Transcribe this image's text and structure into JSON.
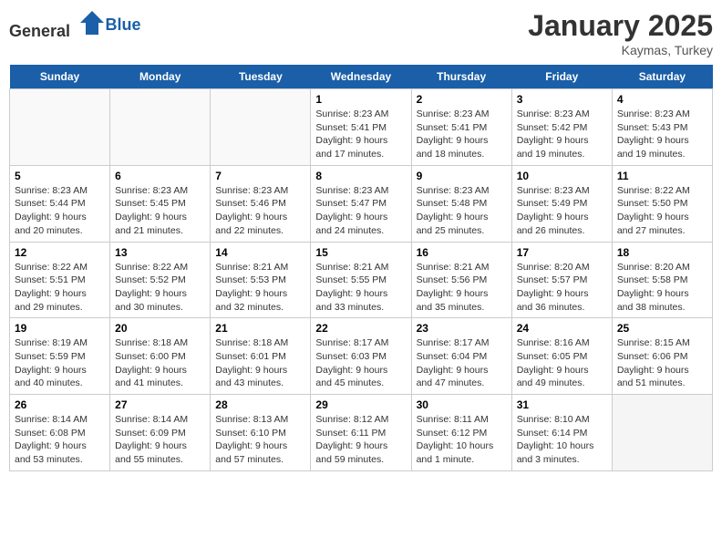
{
  "header": {
    "logo_general": "General",
    "logo_blue": "Blue",
    "title": "January 2025",
    "subtitle": "Kaymas, Turkey"
  },
  "weekdays": [
    "Sunday",
    "Monday",
    "Tuesday",
    "Wednesday",
    "Thursday",
    "Friday",
    "Saturday"
  ],
  "weeks": [
    [
      {
        "day": "",
        "empty": true
      },
      {
        "day": "",
        "empty": true
      },
      {
        "day": "",
        "empty": true
      },
      {
        "day": "1",
        "sunrise": "8:23 AM",
        "sunset": "5:41 PM",
        "daylight": "9 hours and 17 minutes."
      },
      {
        "day": "2",
        "sunrise": "8:23 AM",
        "sunset": "5:41 PM",
        "daylight": "9 hours and 18 minutes."
      },
      {
        "day": "3",
        "sunrise": "8:23 AM",
        "sunset": "5:42 PM",
        "daylight": "9 hours and 19 minutes."
      },
      {
        "day": "4",
        "sunrise": "8:23 AM",
        "sunset": "5:43 PM",
        "daylight": "9 hours and 19 minutes."
      }
    ],
    [
      {
        "day": "5",
        "sunrise": "8:23 AM",
        "sunset": "5:44 PM",
        "daylight": "9 hours and 20 minutes."
      },
      {
        "day": "6",
        "sunrise": "8:23 AM",
        "sunset": "5:45 PM",
        "daylight": "9 hours and 21 minutes."
      },
      {
        "day": "7",
        "sunrise": "8:23 AM",
        "sunset": "5:46 PM",
        "daylight": "9 hours and 22 minutes."
      },
      {
        "day": "8",
        "sunrise": "8:23 AM",
        "sunset": "5:47 PM",
        "daylight": "9 hours and 24 minutes."
      },
      {
        "day": "9",
        "sunrise": "8:23 AM",
        "sunset": "5:48 PM",
        "daylight": "9 hours and 25 minutes."
      },
      {
        "day": "10",
        "sunrise": "8:23 AM",
        "sunset": "5:49 PM",
        "daylight": "9 hours and 26 minutes."
      },
      {
        "day": "11",
        "sunrise": "8:22 AM",
        "sunset": "5:50 PM",
        "daylight": "9 hours and 27 minutes."
      }
    ],
    [
      {
        "day": "12",
        "sunrise": "8:22 AM",
        "sunset": "5:51 PM",
        "daylight": "9 hours and 29 minutes."
      },
      {
        "day": "13",
        "sunrise": "8:22 AM",
        "sunset": "5:52 PM",
        "daylight": "9 hours and 30 minutes."
      },
      {
        "day": "14",
        "sunrise": "8:21 AM",
        "sunset": "5:53 PM",
        "daylight": "9 hours and 32 minutes."
      },
      {
        "day": "15",
        "sunrise": "8:21 AM",
        "sunset": "5:55 PM",
        "daylight": "9 hours and 33 minutes."
      },
      {
        "day": "16",
        "sunrise": "8:21 AM",
        "sunset": "5:56 PM",
        "daylight": "9 hours and 35 minutes."
      },
      {
        "day": "17",
        "sunrise": "8:20 AM",
        "sunset": "5:57 PM",
        "daylight": "9 hours and 36 minutes."
      },
      {
        "day": "18",
        "sunrise": "8:20 AM",
        "sunset": "5:58 PM",
        "daylight": "9 hours and 38 minutes."
      }
    ],
    [
      {
        "day": "19",
        "sunrise": "8:19 AM",
        "sunset": "5:59 PM",
        "daylight": "9 hours and 40 minutes."
      },
      {
        "day": "20",
        "sunrise": "8:18 AM",
        "sunset": "6:00 PM",
        "daylight": "9 hours and 41 minutes."
      },
      {
        "day": "21",
        "sunrise": "8:18 AM",
        "sunset": "6:01 PM",
        "daylight": "9 hours and 43 minutes."
      },
      {
        "day": "22",
        "sunrise": "8:17 AM",
        "sunset": "6:03 PM",
        "daylight": "9 hours and 45 minutes."
      },
      {
        "day": "23",
        "sunrise": "8:17 AM",
        "sunset": "6:04 PM",
        "daylight": "9 hours and 47 minutes."
      },
      {
        "day": "24",
        "sunrise": "8:16 AM",
        "sunset": "6:05 PM",
        "daylight": "9 hours and 49 minutes."
      },
      {
        "day": "25",
        "sunrise": "8:15 AM",
        "sunset": "6:06 PM",
        "daylight": "9 hours and 51 minutes."
      }
    ],
    [
      {
        "day": "26",
        "sunrise": "8:14 AM",
        "sunset": "6:08 PM",
        "daylight": "9 hours and 53 minutes."
      },
      {
        "day": "27",
        "sunrise": "8:14 AM",
        "sunset": "6:09 PM",
        "daylight": "9 hours and 55 minutes."
      },
      {
        "day": "28",
        "sunrise": "8:13 AM",
        "sunset": "6:10 PM",
        "daylight": "9 hours and 57 minutes."
      },
      {
        "day": "29",
        "sunrise": "8:12 AM",
        "sunset": "6:11 PM",
        "daylight": "9 hours and 59 minutes."
      },
      {
        "day": "30",
        "sunrise": "8:11 AM",
        "sunset": "6:12 PM",
        "daylight": "10 hours and 1 minute."
      },
      {
        "day": "31",
        "sunrise": "8:10 AM",
        "sunset": "6:14 PM",
        "daylight": "10 hours and 3 minutes."
      },
      {
        "day": "",
        "empty": true,
        "shaded": true
      }
    ]
  ]
}
